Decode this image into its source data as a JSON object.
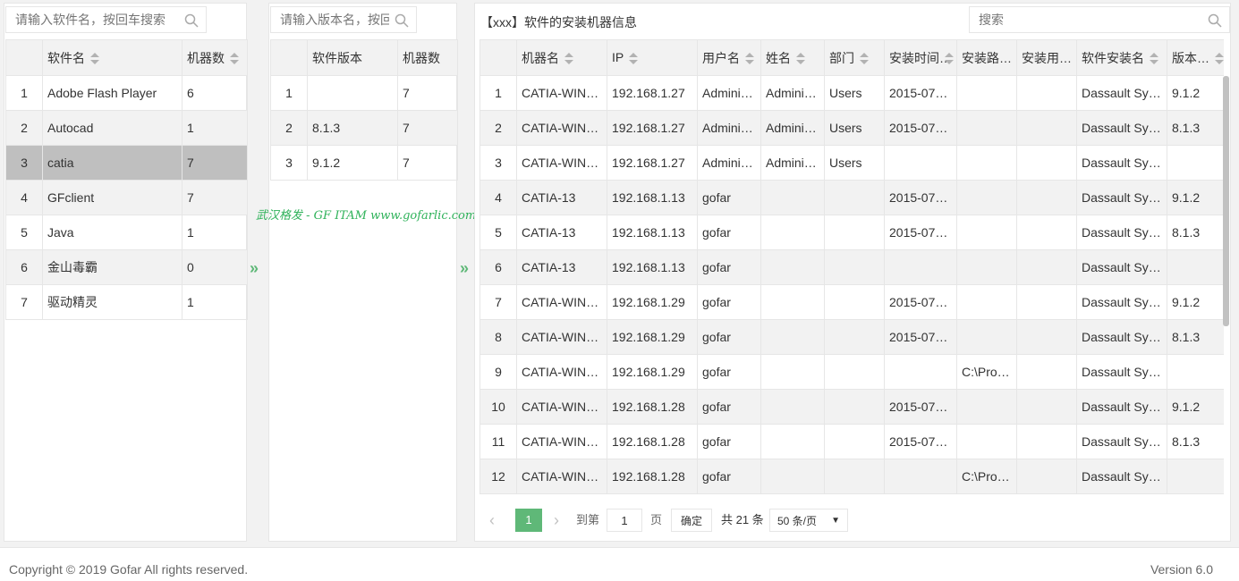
{
  "software_panel": {
    "search_placeholder": "请输入软件名，按回车搜索",
    "columns": [
      "软件名",
      "机器数"
    ],
    "rows": [
      {
        "n": "1",
        "name": "Adobe Flash Player",
        "count": "6"
      },
      {
        "n": "2",
        "name": "Autocad",
        "count": "1"
      },
      {
        "n": "3",
        "name": "catia",
        "count": "7"
      },
      {
        "n": "4",
        "name": "GFclient",
        "count": "7"
      },
      {
        "n": "5",
        "name": "Java",
        "count": "1"
      },
      {
        "n": "6",
        "name": "金山毒霸",
        "count": "0"
      },
      {
        "n": "7",
        "name": "驱动精灵",
        "count": "1"
      }
    ],
    "selected_row": 3
  },
  "version_panel": {
    "search_placeholder": "请输入版本名，按回",
    "columns": [
      "软件版本",
      "机器数"
    ],
    "rows": [
      {
        "n": "1",
        "version": "",
        "count": "7"
      },
      {
        "n": "2",
        "version": "8.1.3",
        "count": "7"
      },
      {
        "n": "3",
        "version": "9.1.2",
        "count": "7"
      }
    ]
  },
  "arrow_glyph": "»",
  "watermark": "武汉格发 - GF ITAM  www.gofarlic.com",
  "machines_panel": {
    "title": "【xxx】软件的安装机器信息",
    "search_placeholder": "搜索",
    "columns": [
      "机器名",
      "IP",
      "用户名",
      "姓名",
      "部门",
      "安装时间",
      "安装路…",
      "安装用…",
      "软件安装名",
      "版本名"
    ],
    "rows": [
      [
        "1",
        "CATIA-WIN…",
        "192.168.1.27",
        "Admini…",
        "Admini…",
        "Users",
        "2015-07…",
        "",
        "",
        "Dassault Sy…",
        "9.1.2"
      ],
      [
        "2",
        "CATIA-WIN…",
        "192.168.1.27",
        "Admini…",
        "Admini…",
        "Users",
        "2015-07…",
        "",
        "",
        "Dassault Sy…",
        "8.1.3"
      ],
      [
        "3",
        "CATIA-WIN…",
        "192.168.1.27",
        "Admini…",
        "Admini…",
        "Users",
        "",
        "",
        "",
        "Dassault Sy…",
        ""
      ],
      [
        "4",
        "CATIA-13",
        "192.168.1.13",
        "gofar",
        "",
        "",
        "2015-07…",
        "",
        "",
        "Dassault Sy…",
        "9.1.2"
      ],
      [
        "5",
        "CATIA-13",
        "192.168.1.13",
        "gofar",
        "",
        "",
        "2015-07…",
        "",
        "",
        "Dassault Sy…",
        "8.1.3"
      ],
      [
        "6",
        "CATIA-13",
        "192.168.1.13",
        "gofar",
        "",
        "",
        "",
        "",
        "",
        "Dassault Sy…",
        ""
      ],
      [
        "7",
        "CATIA-WIN…",
        "192.168.1.29",
        "gofar",
        "",
        "",
        "2015-07…",
        "",
        "",
        "Dassault Sy…",
        "9.1.2"
      ],
      [
        "8",
        "CATIA-WIN…",
        "192.168.1.29",
        "gofar",
        "",
        "",
        "2015-07…",
        "",
        "",
        "Dassault Sy…",
        "8.1.3"
      ],
      [
        "9",
        "CATIA-WIN…",
        "192.168.1.29",
        "gofar",
        "",
        "",
        "",
        "C:\\Pro…",
        "",
        "Dassault Sy…",
        ""
      ],
      [
        "10",
        "CATIA-WIN…",
        "192.168.1.28",
        "gofar",
        "",
        "",
        "2015-07…",
        "",
        "",
        "Dassault Sy…",
        "9.1.2"
      ],
      [
        "11",
        "CATIA-WIN…",
        "192.168.1.28",
        "gofar",
        "",
        "",
        "2015-07…",
        "",
        "",
        "Dassault Sy…",
        "8.1.3"
      ],
      [
        "12",
        "CATIA-WIN…",
        "192.168.1.28",
        "gofar",
        "",
        "",
        "",
        "C:\\Pro…",
        "",
        "Dassault Sy…",
        ""
      ]
    ]
  },
  "pager": {
    "prev": "‹",
    "current_page": "1",
    "next": "›",
    "goto_label": "到第",
    "goto_value": "1",
    "page_unit": "页",
    "confirm": "确定",
    "total": "共 21 条",
    "page_size": "50 条/页"
  },
  "footer": {
    "copyright": "Copyright © 2019 Gofar All rights reserved.",
    "version": "Version 6.0"
  },
  "colors": {
    "accent": "#5FB878",
    "selected_row": "#bfbfbf",
    "stripe": "#f2f2f2"
  }
}
